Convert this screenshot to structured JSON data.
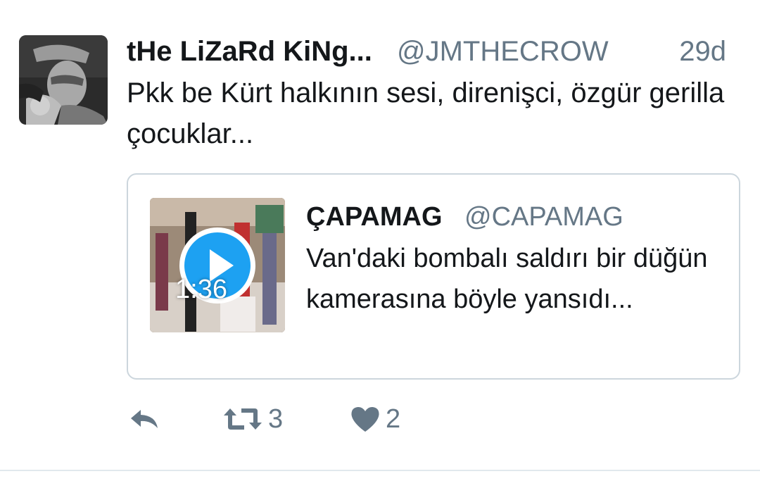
{
  "tweet": {
    "display_name": "tHe LiZaRd KiNg...",
    "handle": "@JMTHECROW",
    "timestamp": "29d",
    "text": "Pkk be Kürt halkının sesi, direnişci, özgür gerilla çocuklar..."
  },
  "quote": {
    "display_name": "ÇAPAMAG",
    "handle": "@CAPAMAG",
    "text": "Van'daki bombalı saldırı bir düğün kamerasına böyle yansıdı...",
    "video_duration": "1:36"
  },
  "actions": {
    "reply_icon": "reply-icon",
    "retweet_icon": "retweet-icon",
    "retweet_count": "3",
    "like_icon": "heart-icon",
    "like_count": "2"
  },
  "colors": {
    "text_primary": "#14171a",
    "text_secondary": "#657786",
    "accent": "#1da1f2",
    "border": "#ccd6dd"
  }
}
